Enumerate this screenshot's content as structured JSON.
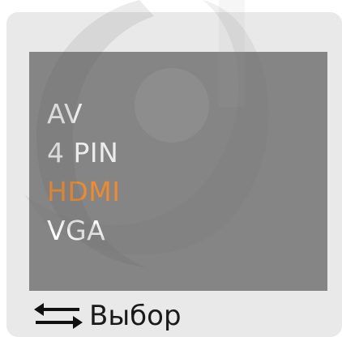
{
  "menu": {
    "items": [
      {
        "label": "AV"
      },
      {
        "label": "4 PIN"
      },
      {
        "label": "HDMI"
      },
      {
        "label": "VGA"
      }
    ],
    "selected_label": "HDMI"
  },
  "hint": {
    "icon": "swap-arrows-icon",
    "label": "Выбор"
  },
  "colors": {
    "accent": "#f08a2c",
    "panel": "#858585",
    "frame": "#e9e9e9",
    "text": "#ececec"
  }
}
